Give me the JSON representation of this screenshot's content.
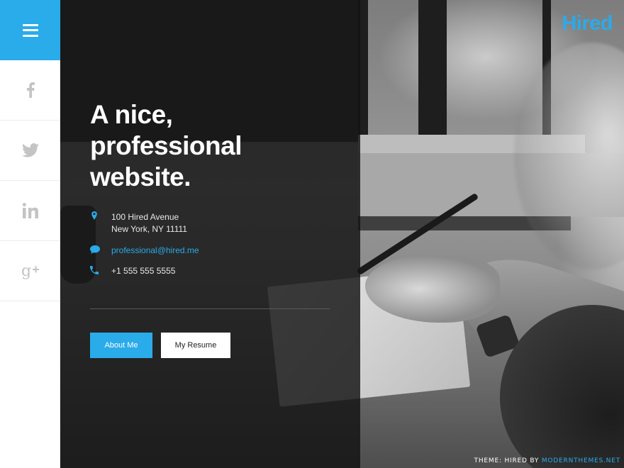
{
  "brand": {
    "logo": "Hired",
    "accent": "#2aabea"
  },
  "sidebar": {
    "menu_icon": "hamburger-icon",
    "social": [
      {
        "name": "facebook",
        "icon": "facebook-icon"
      },
      {
        "name": "twitter",
        "icon": "twitter-icon"
      },
      {
        "name": "linkedin",
        "icon": "linkedin-icon"
      },
      {
        "name": "google-plus",
        "icon": "google-plus-icon"
      }
    ]
  },
  "hero": {
    "headline": [
      "A nice,",
      "professional",
      "website."
    ],
    "contact": {
      "address_line1": "100 Hired Avenue",
      "address_line2": "New York, NY 11111",
      "email": "professional@hired.me",
      "phone": "+1 555 555 5555",
      "address_icon": "map-pin-icon",
      "email_icon": "chat-bubble-icon",
      "phone_icon": "phone-icon"
    },
    "buttons": {
      "about": "About Me",
      "resume": "My Resume"
    }
  },
  "footer": {
    "credit_prefix": "THEME: HIRED BY ",
    "credit_link": "MODERNTHEMES.NET"
  }
}
